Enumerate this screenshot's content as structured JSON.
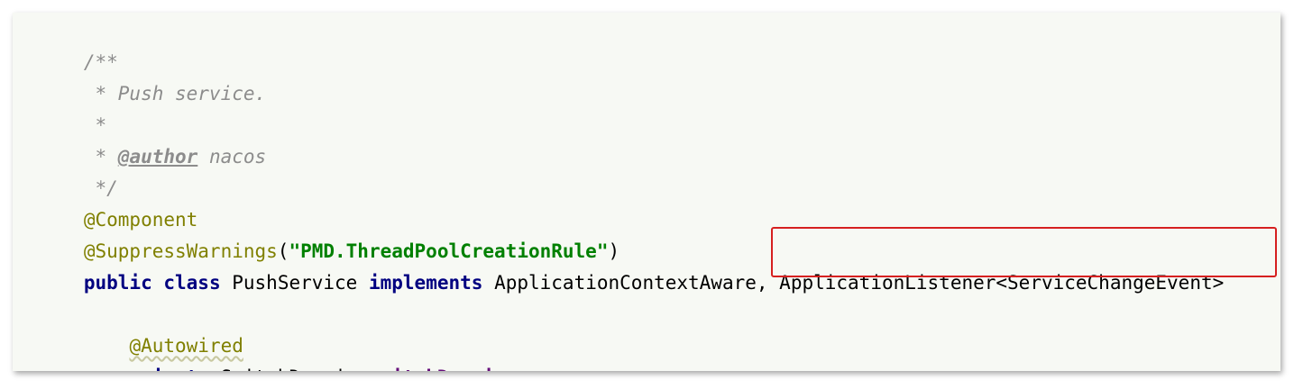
{
  "code": {
    "line1": {
      "comment": "/**"
    },
    "line2": {
      "comment": " * Push service."
    },
    "line3": {
      "comment": " *"
    },
    "line4": {
      "prefix": " * ",
      "doctag": "@author",
      "suffix": " nacos"
    },
    "line5": {
      "comment": " */"
    },
    "line6": {
      "annotation": "@Component"
    },
    "line7": {
      "annotation": "@SuppressWarnings",
      "open": "(",
      "string": "\"PMD.ThreadPoolCreationRule\"",
      "close": ")"
    },
    "line8": {
      "kw_public": "public",
      "kw_class": "class",
      "class_name": "PushService",
      "kw_implements": "implements",
      "iface1": "ApplicationContextAware,",
      "iface2": "ApplicationListener<ServiceChangeEvent>"
    },
    "line10": {
      "indent": "    ",
      "annotation": "@Autowired"
    },
    "line11": {
      "indent": "    ",
      "kw_private": "private",
      "type": "SwitchDomain",
      "field": "switchDomain",
      "semicolon": ";"
    }
  },
  "highlight": {
    "color": "#d62020"
  }
}
